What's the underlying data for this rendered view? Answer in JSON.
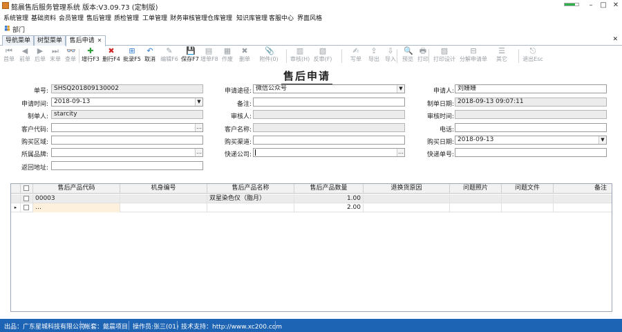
{
  "window": {
    "title": "懿晨售后服务管理系统 版本:V3.09.73 (定制版)",
    "progress": 0.75,
    "controls": [
      "–",
      "□",
      "✕"
    ]
  },
  "menu": [
    "系统管理",
    "基础资料",
    "会员管理",
    "售后管理",
    "质检管理",
    "工单管理",
    "财务审核管理",
    "仓库管理",
    "知识库管理",
    "客服中心",
    "界面风格"
  ],
  "dept": {
    "label": "部门"
  },
  "tabs": [
    {
      "label": "导航菜单"
    },
    {
      "label": "树型菜单"
    },
    {
      "label": "售后申请",
      "close": "✕"
    }
  ],
  "tabbar_close": "✕",
  "toolbar": [
    {
      "label": "首单",
      "icon": "⏮",
      "enabled": false
    },
    {
      "label": "前单",
      "icon": "◀",
      "enabled": false
    },
    {
      "label": "后单",
      "icon": "▶",
      "enabled": false
    },
    {
      "label": "末单",
      "icon": "⏭",
      "enabled": false
    },
    {
      "label": "查单",
      "icon": "👓",
      "enabled": false
    },
    {
      "label": "增行F3",
      "icon": "✚",
      "enabled": true
    },
    {
      "label": "删行F4",
      "icon": "✖",
      "enabled": true
    },
    {
      "label": "批录F5",
      "icon": "⊞",
      "enabled": true
    },
    {
      "label": "取消",
      "icon": "↶",
      "enabled": true
    },
    {
      "label": "编辑F6",
      "icon": "✎",
      "enabled": false
    },
    {
      "label": "保存F7",
      "icon": "💾",
      "enabled": true
    },
    {
      "label": "增单F8",
      "icon": "▤",
      "enabled": false
    },
    {
      "label": "作废",
      "icon": "▦",
      "enabled": false
    },
    {
      "label": "删单",
      "icon": "✖",
      "enabled": false
    },
    {
      "label": "附件(0)",
      "icon": "📎",
      "enabled": false
    },
    {
      "label": "审核(H)",
      "icon": "▥",
      "enabled": false
    },
    {
      "label": "反审(F)",
      "icon": "▧",
      "enabled": false
    },
    {
      "label": "写单",
      "icon": "✍",
      "enabled": false
    },
    {
      "label": "导出",
      "icon": "⇪",
      "enabled": false
    },
    {
      "label": "导入",
      "icon": "⇩",
      "enabled": false
    },
    {
      "label": "预览",
      "icon": "🔍",
      "enabled": false
    },
    {
      "label": "打印",
      "icon": "🖶",
      "enabled": false
    },
    {
      "label": "打印设计",
      "icon": "▨",
      "enabled": false
    },
    {
      "label": "分解申请单",
      "icon": "⊟",
      "enabled": false
    },
    {
      "label": "其它",
      "icon": "☰",
      "enabled": false
    },
    {
      "label": "退出Esc",
      "icon": "⎋",
      "enabled": false
    }
  ],
  "form": {
    "title": "售后申请",
    "fields": {
      "doc_no": {
        "label": "单号:",
        "value": "SHSQ201809130002"
      },
      "channel": {
        "label": "申请途径:",
        "value": "微信公众号"
      },
      "applicant": {
        "label": "申请人:",
        "value": "刘姗姗"
      },
      "apply_time": {
        "label": "申请时间:",
        "value": "2018-09-13"
      },
      "remark": {
        "label": "备注:",
        "value": ""
      },
      "create_date": {
        "label": "制单日期:",
        "value": "2018-09-13 09:07:11"
      },
      "creator": {
        "label": "制单人:",
        "value": "starcity"
      },
      "auditor": {
        "label": "审核人:",
        "value": ""
      },
      "audit_time": {
        "label": "审核时间:",
        "value": ""
      },
      "customer_code": {
        "label": "客户代码:",
        "value": ""
      },
      "customer_name": {
        "label": "客户名称:",
        "value": ""
      },
      "phone": {
        "label": "电话:",
        "value": ""
      },
      "region": {
        "label": "购买区域:",
        "value": ""
      },
      "purchase_channel": {
        "label": "购买渠道:",
        "value": ""
      },
      "purchase_date": {
        "label": "购买日期:",
        "value": "2018-09-13"
      },
      "brand": {
        "label": "所属品牌:",
        "value": ""
      },
      "courier": {
        "label": "快递公司:",
        "value": ""
      },
      "tracking_no": {
        "label": "快递单号:",
        "value": ""
      },
      "return_address": {
        "label": "返回地址:",
        "value": ""
      }
    }
  },
  "grid": {
    "columns": [
      "售后产品代码",
      "机身编号",
      "售后产品名称",
      "售后产品数量",
      "退换货原因",
      "问题照片",
      "问题文件",
      "备注"
    ],
    "rows": [
      [
        "00003",
        "",
        "双星染色仪（脂月）",
        "1.00",
        "",
        "",
        "",
        ""
      ],
      [
        "",
        "",
        "",
        "2.00",
        "",
        "",
        "",
        ""
      ]
    ]
  },
  "status": {
    "publisher": "出品：广东星城科技有限公司",
    "account": "帐套：懿晨项目",
    "operator": "操作员:张三(01)",
    "support": "技术支持：http://www.xc200.com"
  }
}
